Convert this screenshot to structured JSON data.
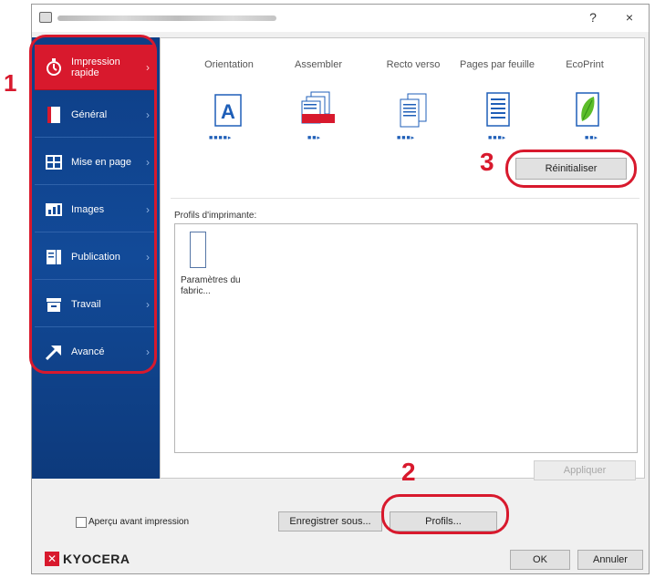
{
  "window": {
    "help": "?",
    "close": "×"
  },
  "sidebar": {
    "items": [
      {
        "label": "Impression rapide",
        "icon": "stopwatch-icon",
        "active": true
      },
      {
        "label": "Général",
        "icon": "page-icon"
      },
      {
        "label": "Mise en page",
        "icon": "layout-icon"
      },
      {
        "label": "Images",
        "icon": "image-icon"
      },
      {
        "label": "Publication",
        "icon": "publication-icon"
      },
      {
        "label": "Travail",
        "icon": "job-icon"
      },
      {
        "label": "Avancé",
        "icon": "advanced-arrow-icon"
      }
    ]
  },
  "features": [
    {
      "label": "Orientation",
      "icon": "orientation-a-icon"
    },
    {
      "label": "Assembler",
      "icon": "collate-icon"
    },
    {
      "label": "Recto verso",
      "icon": "duplex-icon"
    },
    {
      "label": "Pages par feuille",
      "icon": "pages-per-sheet-icon"
    },
    {
      "label": "EcoPrint",
      "icon": "ecoprint-leaf-icon"
    }
  ],
  "buttons": {
    "reset": "Réinitialiser",
    "apply": "Appliquer",
    "save_as": "Enregistrer sous...",
    "profiles": "Profils...",
    "ok": "OK",
    "cancel": "Annuler"
  },
  "profiles": {
    "label": "Profils d'imprimante:",
    "items": [
      {
        "label": "Paramètres du fabric..."
      }
    ]
  },
  "preview_label": "Aperçu avant impression",
  "brand": "KYOCERA",
  "callouts": [
    "1",
    "2",
    "3"
  ],
  "colors": {
    "accent_red": "#d8192d",
    "sidebar_blue": "#124a98",
    "dot_blue": "#1f5fb8"
  }
}
